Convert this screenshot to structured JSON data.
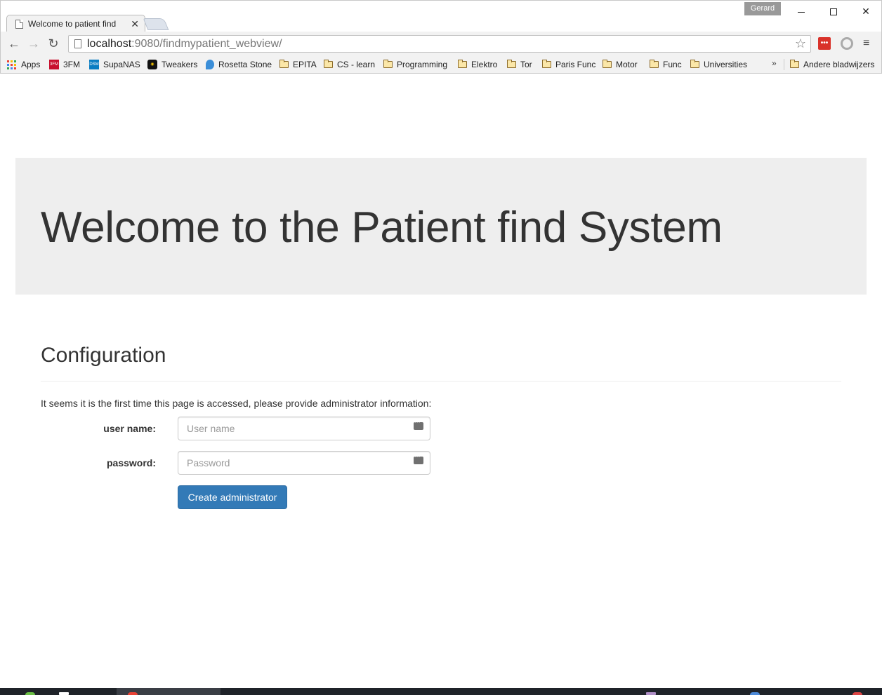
{
  "window": {
    "tab_title": "Welcome to patient find",
    "tab_close_glyph": "✕",
    "profile_name": "Gerard",
    "close_glyph": "✕"
  },
  "toolbar": {
    "back_glyph": "←",
    "forward_glyph": "→",
    "reload_glyph": "↻",
    "url_host": "localhost",
    "url_path": ":9080/findmypatient_webview/",
    "star_glyph": "☆",
    "menu_glyph": "≡",
    "ext_label": "•••"
  },
  "bookmarks": {
    "items": [
      {
        "label": "Apps",
        "icon": "apps-grid-icon"
      },
      {
        "label": "3FM",
        "icon": "3fm-icon"
      },
      {
        "label": "SupaNAS",
        "icon": "supanas-icon"
      },
      {
        "label": "Tweakers",
        "icon": "tweakers-icon"
      },
      {
        "label": "Rosetta Stone",
        "icon": "rosetta-stone-icon"
      },
      {
        "label": "EPITA",
        "icon": "folder-icon"
      },
      {
        "label": "CS - learn",
        "icon": "folder-icon"
      },
      {
        "label": "Programming",
        "icon": "folder-icon"
      },
      {
        "label": "Elektro",
        "icon": "folder-icon"
      },
      {
        "label": "Tor",
        "icon": "folder-icon"
      },
      {
        "label": "Paris Func",
        "icon": "folder-icon"
      },
      {
        "label": "Motor",
        "icon": "folder-icon"
      },
      {
        "label": "Func",
        "icon": "folder-icon"
      },
      {
        "label": "Universities",
        "icon": "folder-icon"
      }
    ],
    "overflow_glyph": "»",
    "other_label": "Andere bladwijzers"
  },
  "page": {
    "jumbotron_title": "Welcome to the Patient find System",
    "section_title": "Configuration",
    "intro": "It seems it is the first time this page is accessed, please provide administrator information:",
    "username_label": "user name:",
    "username_placeholder": "User name",
    "password_label": "password:",
    "password_placeholder": "Password",
    "submit_label": "Create administrator"
  },
  "colors": {
    "primary_button": "#337ab7",
    "jumbotron_bg": "#eeeeee",
    "text": "#333333"
  }
}
